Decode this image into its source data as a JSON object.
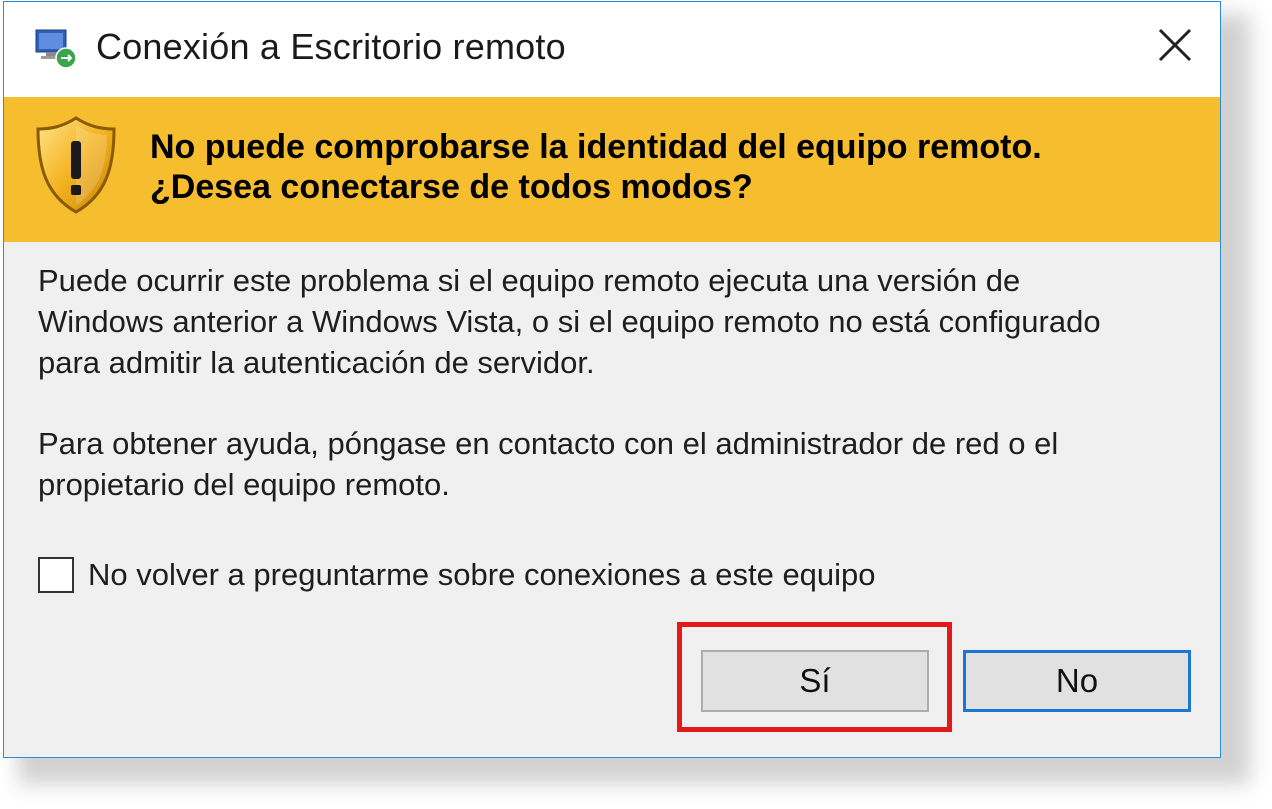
{
  "window": {
    "title": "Conexión a Escritorio remoto",
    "app_icon": "remote-desktop-icon",
    "close_icon": "close-icon"
  },
  "banner": {
    "icon": "warning-shield-icon",
    "line1": "No puede comprobarse la identidad del equipo remoto.",
    "line2": "¿Desea conectarse de todos modos?",
    "background": "#f6bd2e"
  },
  "body": {
    "paragraph1": [
      "Puede ocurrir este problema si el equipo remoto ejecuta una versión de",
      "Windows anterior a Windows Vista, o si el equipo remoto no está configurado",
      "para admitir la autenticación de servidor."
    ],
    "paragraph2": [
      "Para obtener ayuda, póngase en contacto con el administrador de red o el",
      "propietario del equipo remoto."
    ]
  },
  "checkbox": {
    "label": "No volver a preguntarme sobre conexiones a este equipo",
    "checked": false
  },
  "buttons": {
    "yes_label": "Sí",
    "no_label": "No"
  },
  "colors": {
    "accent_border": "#1a78d4",
    "highlight": "#e41a1a"
  }
}
